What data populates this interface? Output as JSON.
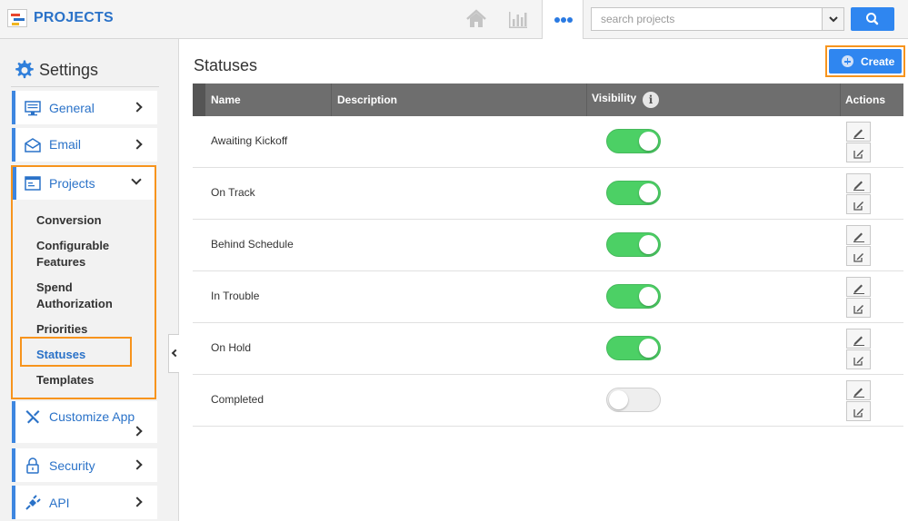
{
  "header": {
    "app_title": "PROJECTS",
    "search": {
      "placeholder": "search projects",
      "value": ""
    },
    "icons": {
      "home": "home-icon",
      "analytics": "bar-chart-icon",
      "more": "ellipsis-icon",
      "dropdown": "chevron-down-icon",
      "search": "search-icon"
    }
  },
  "sidebar": {
    "title": "Settings",
    "items": [
      {
        "label": "General",
        "icon": "monitor-icon"
      },
      {
        "label": "Email",
        "icon": "envelope-icon"
      },
      {
        "label": "Projects",
        "icon": "window-icon",
        "expanded": true,
        "children": [
          "Conversion",
          "Configurable Features",
          "Spend Authorization",
          "Priorities",
          "Statuses",
          "Templates"
        ],
        "active_child": "Statuses"
      },
      {
        "label": "Customize App",
        "icon": "tools-icon"
      },
      {
        "label": "Security",
        "icon": "lock-icon"
      },
      {
        "label": "API",
        "icon": "plug-icon"
      }
    ]
  },
  "main": {
    "title": "Statuses",
    "create_label": "Create",
    "columns": [
      "Name",
      "Description",
      "Visibility",
      "Actions"
    ],
    "rows": [
      {
        "name": "Awaiting Kickoff",
        "description": "",
        "visible": true
      },
      {
        "name": "On Track",
        "description": "",
        "visible": true
      },
      {
        "name": "Behind Schedule",
        "description": "",
        "visible": true
      },
      {
        "name": "In Trouble",
        "description": "",
        "visible": true
      },
      {
        "name": "On Hold",
        "description": "",
        "visible": true
      },
      {
        "name": "Completed",
        "description": "",
        "visible": false
      }
    ]
  },
  "colors": {
    "accent": "#2f86f0",
    "highlight": "#f7941d",
    "toggle_on": "#4cd065",
    "header_bg": "#6e6e6e"
  }
}
